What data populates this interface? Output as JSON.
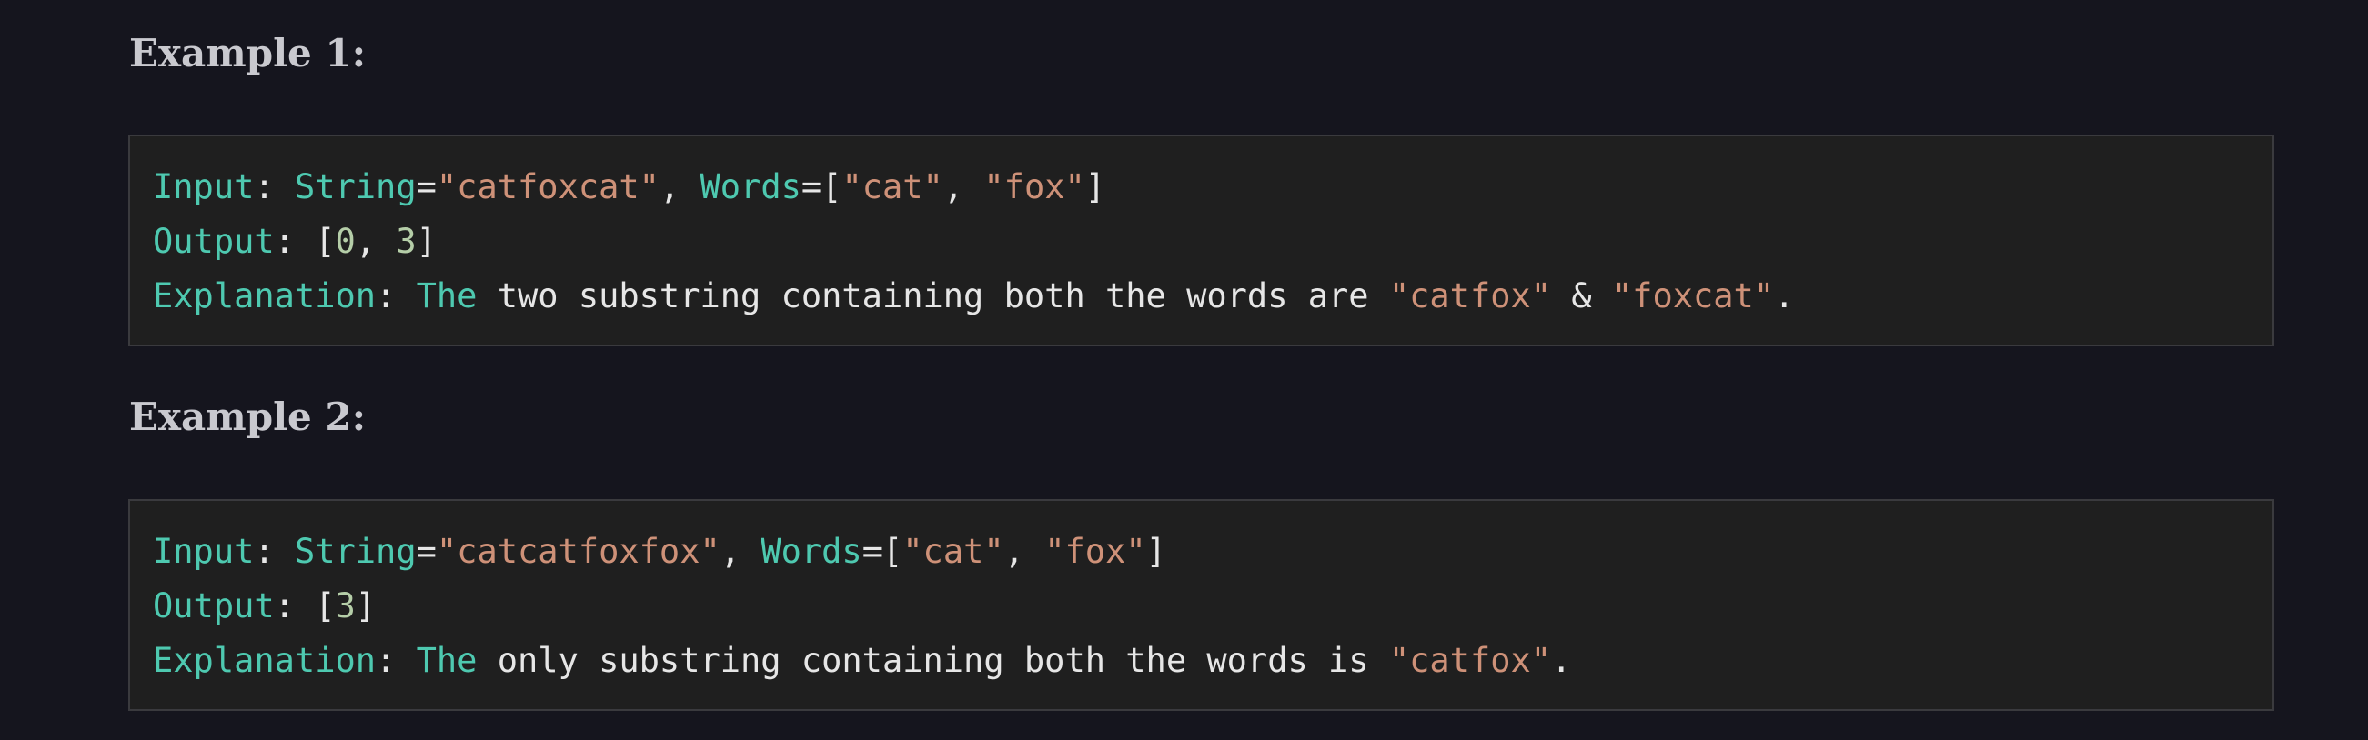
{
  "example1": {
    "heading": "Example 1:",
    "input_label": "Input",
    "string_key": "String",
    "string_value": "\"catfoxcat\"",
    "words_key": "Words",
    "word_a": "\"cat\"",
    "word_b": "\"fox\"",
    "output_label": "Output",
    "output_n1": "0",
    "output_n2": "3",
    "explanation_label": "Explanation",
    "explanation_the": "The",
    "explanation_text": " two substring containing both the words are ",
    "explanation_s1": "\"catfox\"",
    "explanation_amp": " & ",
    "explanation_s2": "\"foxcat\"",
    "explanation_end": "."
  },
  "example2": {
    "heading": "Example 2:",
    "input_label": "Input",
    "string_key": "String",
    "string_value": "\"catcatfoxfox\"",
    "words_key": "Words",
    "word_a": "\"cat\"",
    "word_b": "\"fox\"",
    "output_label": "Output",
    "output_n1": "3",
    "explanation_label": "Explanation",
    "explanation_the": "The",
    "explanation_text": " only substring containing both the words is ",
    "explanation_s1": "\"catfox\"",
    "explanation_end": "."
  }
}
